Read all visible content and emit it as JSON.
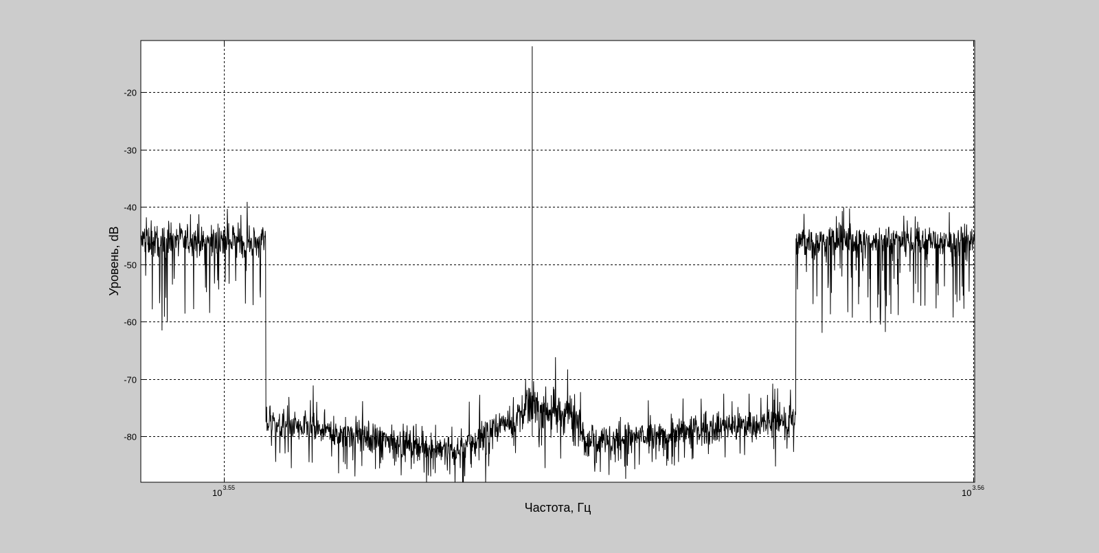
{
  "chart_data": {
    "type": "line",
    "xlabel": "Частота, Гц",
    "ylabel": "Уровень, dB",
    "x_scale": "log",
    "x_ticks": [
      {
        "base": "10",
        "exp": "3.55",
        "value": 3548.13
      },
      {
        "base": "10",
        "exp": "3.56",
        "value": 3630.78
      }
    ],
    "y_ticks": [
      -20,
      -30,
      -40,
      -50,
      -60,
      -70,
      -80
    ],
    "xlim": [
      3539.1,
      3630.9
    ],
    "ylim": [
      -88,
      -11
    ],
    "grid": true,
    "colors": {
      "background": "#cccccc",
      "plot_area": "#ffffff",
      "trace": "#000000"
    },
    "series": [
      {
        "segments": [
          {
            "x_start": 3539.1,
            "x_end": 3552.7,
            "mean": -46,
            "spread": 4,
            "spike_depth": 14
          },
          {
            "x_start": 3552.7,
            "x_end": 3574.0,
            "mean": -81,
            "spread": 4,
            "spike_depth": 6,
            "start_level": -74,
            "end_level": -84
          },
          {
            "x_start": 3574.0,
            "x_end": 3581.1,
            "mean": -80,
            "spread": 4,
            "spike_depth": 6,
            "start_level": -84,
            "end_level": -72
          },
          {
            "x_start": 3581.1,
            "x_end": 3587.5,
            "mean": -76,
            "spread": 5,
            "spike_depth": 8,
            "start_level": -72,
            "end_level": -78
          },
          {
            "x_start": 3587.5,
            "x_end": 3611.0,
            "mean": -82,
            "spread": 4,
            "spike_depth": 6,
            "start_level": -80,
            "end_level": -72
          },
          {
            "x_start": 3611.0,
            "x_end": 3630.9,
            "mean": -46,
            "spread": 4,
            "spike_depth": 14
          }
        ],
        "peaks": [
          {
            "x": 3581.9,
            "y": -12
          },
          {
            "x": 3581.9,
            "y": -58
          }
        ]
      }
    ]
  }
}
